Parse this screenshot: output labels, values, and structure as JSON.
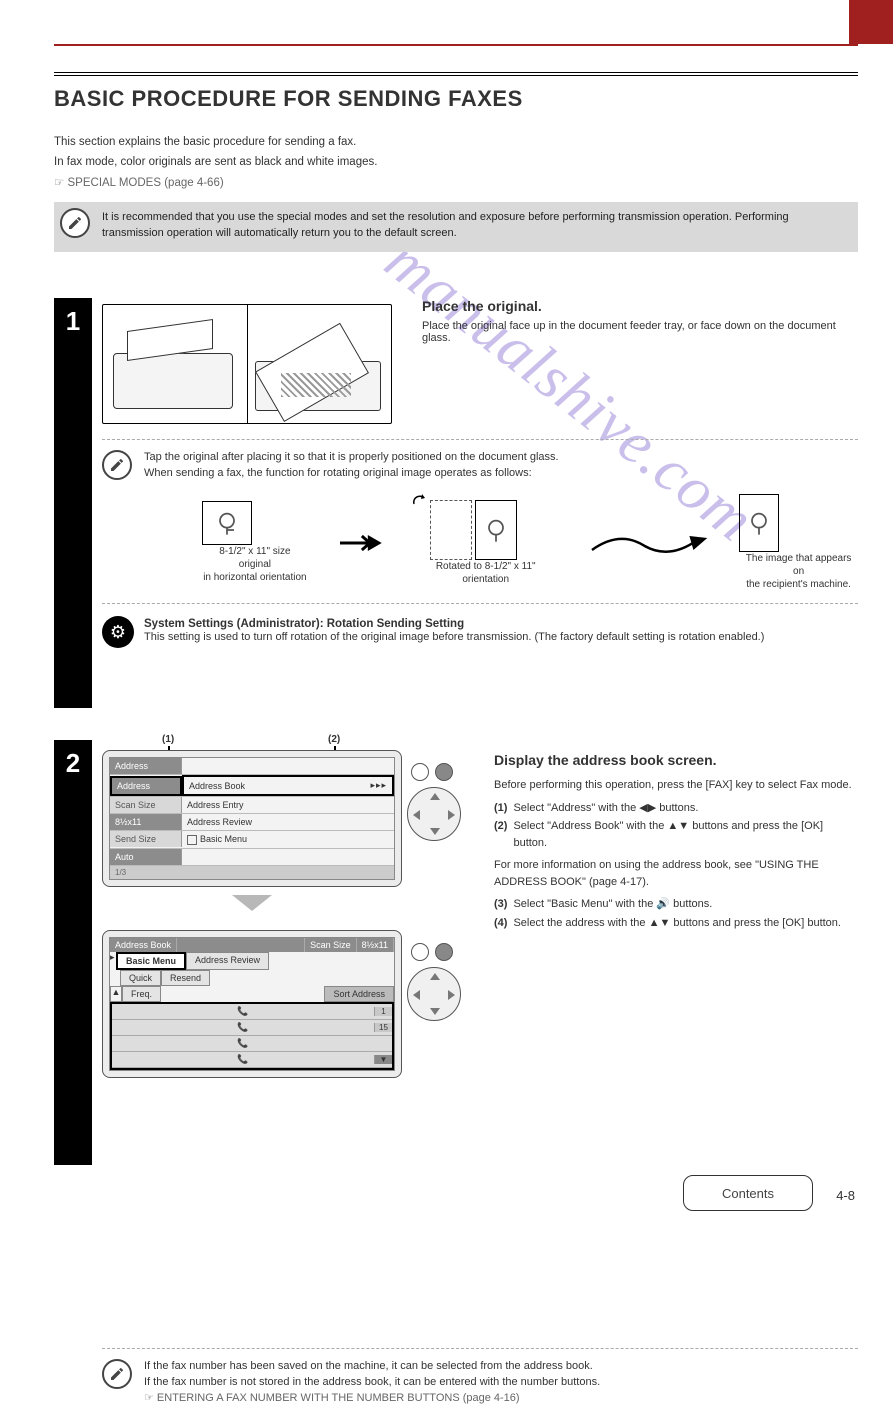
{
  "header": {
    "title": "BASIC PROCEDURE FOR SENDING FAXES"
  },
  "intro": {
    "p1": "This section explains the basic procedure for sending a fax.",
    "p2": "In fax mode, color originals are sent as black and white images.",
    "ref": "☞ SPECIAL MODES (page 4-66)"
  },
  "top_note": {
    "text": "It is recommended that you use the special modes and set the resolution and exposure before performing transmission operation. Performing transmission operation will automatically return you to the default screen."
  },
  "step1": {
    "number": "1",
    "title": "Place the original.",
    "right": "Place the original face up in the document feeder tray, or face down on the document glass.",
    "note_p1": "Tap the original after placing it so that it is properly positioned on the document glass.",
    "note_p2": "When sending a fax, the function for rotating original image operates as follows:",
    "rotate": {
      "left_label_1": "8-1/2\" x 11\" size original",
      "left_label_2": "in horizontal orientation",
      "mid_label": "Rotated to 8-1/2\" x 11\" orientation",
      "right_label": "The image that appears on",
      "right_label_2": "the recipient's machine."
    },
    "gear": {
      "title": "System Settings (Administrator): Rotation Sending Setting",
      "text": "This setting is used to turn off rotation of the original image before transmission. (The factory default setting is rotation enabled.)"
    }
  },
  "step2": {
    "number": "2",
    "panel1": {
      "header": "Address",
      "rows": [
        {
          "left": "Address",
          "right": "Address Book",
          "highlight": true
        },
        {
          "left": "Scan Size",
          "right": "Address Entry"
        },
        {
          "left": "8½x11",
          "right": "Address Review"
        },
        {
          "left": "Send Size",
          "right": "Basic Menu",
          "icon": true
        },
        {
          "left": "Auto",
          "right": ""
        }
      ],
      "footer": "1/3"
    },
    "panel2": {
      "strip": [
        {
          "label": "Address Book"
        },
        {
          "label": "Scan Size",
          "val": "8½x11"
        }
      ],
      "tabs": [
        {
          "label": "Basic Menu",
          "active": true
        },
        {
          "label": "Address Review"
        },
        {
          "label": "Resend"
        }
      ],
      "freq_tabs": [
        {
          "label": "Quick"
        },
        {
          "label": "Freq."
        },
        {
          "label": "Sort Address"
        }
      ],
      "nums": [
        "1",
        "15"
      ]
    },
    "right": {
      "title": "Display the address book screen.",
      "p1": "Before performing this operation, press the [FAX] key to select Fax mode.",
      "b1_num": "(1)",
      "b1": "Select \"Address\" with the ◀▶ buttons.",
      "b2_num": "(2)",
      "b2": "Select \"Address Book\" with the ▲▼ buttons and press the [OK] button.",
      "p2": "For more information on using the address book, see \"USING THE ADDRESS BOOK\" (page 4-17).",
      "b3_num": "(3)",
      "b3_a": "Select \"Basic Menu\" with the ",
      "b3_b": " buttons.",
      "b4_num": "(4)",
      "b4": "Select the address with the ▲▼ buttons and press the [OK] button."
    },
    "note": {
      "p1": "If the fax number has been saved on the machine, it can be selected from the address book.",
      "p2": "If the fax number is not stored in the address book, it can be entered with the number buttons.",
      "ref": "☞ ENTERING A FAX NUMBER WITH THE NUMBER BUTTONS (page 4-16)"
    }
  },
  "footer": {
    "contents": "Contents",
    "page": "4-8"
  },
  "watermark": "manualshive.com"
}
